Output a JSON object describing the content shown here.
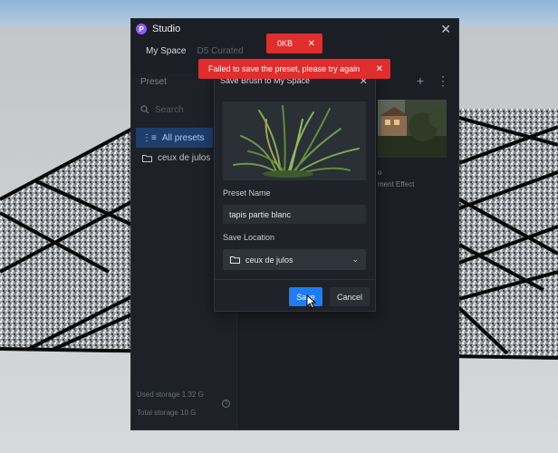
{
  "window": {
    "title": "Studio",
    "logo": "P"
  },
  "tabs": [
    {
      "label": "My Space"
    },
    {
      "label": "D5 Curated"
    }
  ],
  "sidebar": {
    "title": "Preset",
    "search_placeholder": "Search",
    "items": [
      {
        "label": "All presets"
      },
      {
        "label": "ceux de julos"
      }
    ],
    "storage": {
      "used": "Used storage 1.32 G",
      "total": "Total storage 10 G"
    }
  },
  "content": {
    "item_name": "o",
    "item_sub": "ment Effect"
  },
  "dialog": {
    "title": "Save Brush to My Space",
    "preset_name_label": "Preset Name",
    "preset_name_value": "tapis partie blanc",
    "save_location_label": "Save Location",
    "save_location_value": "ceux de julos",
    "save_label": "Save",
    "cancel_label": "Cancel"
  },
  "toasts": [
    {
      "text": "0KB"
    },
    {
      "text": "Failed to save the preset, please try again"
    }
  ],
  "colors": {
    "accent": "#1f7cf2",
    "error": "#e02d2d",
    "selection": "#1f3e6c",
    "panel": "#1b1e24"
  }
}
